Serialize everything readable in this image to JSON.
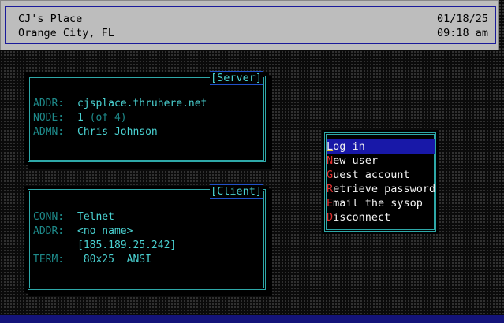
{
  "header": {
    "system_name": "CJ's Place",
    "location": "Orange City, FL",
    "date": "01/18/25",
    "time": "09:18 am"
  },
  "server": {
    "title": "[Server]",
    "addr_label": "ADDR:",
    "addr": "cjsplace.thruhere.net",
    "node_label": "NODE:",
    "node": "1",
    "node_of": "(of 4)",
    "admin_label": "ADMN:",
    "admin": "Chris Johnson"
  },
  "client": {
    "title": "[Client]",
    "conn_label": "CONN:",
    "conn": "Telnet",
    "addr_label": "ADDR:",
    "addr_name": "<no name>",
    "addr_ip": "[185.189.25.242]",
    "term_label": "TERM:",
    "term_size": "80x25",
    "term_type": "ANSI"
  },
  "menu": {
    "items": [
      {
        "hotkey": "L",
        "rest": "og in",
        "selected": true
      },
      {
        "hotkey": "N",
        "rest": "ew user"
      },
      {
        "hotkey": "G",
        "rest": "uest account"
      },
      {
        "hotkey": "R",
        "rest": "etrieve password"
      },
      {
        "hotkey": "E",
        "rest": "mail the sysop"
      },
      {
        "hotkey": "D",
        "rest": "isconnect"
      }
    ]
  },
  "colors": {
    "header_bg": "#bdbdbd",
    "frame": "#2ea8a8",
    "value": "#4ad2d2",
    "label": "#1e8a8a",
    "hotkey": "#e03030",
    "selection": "#1818a8"
  }
}
